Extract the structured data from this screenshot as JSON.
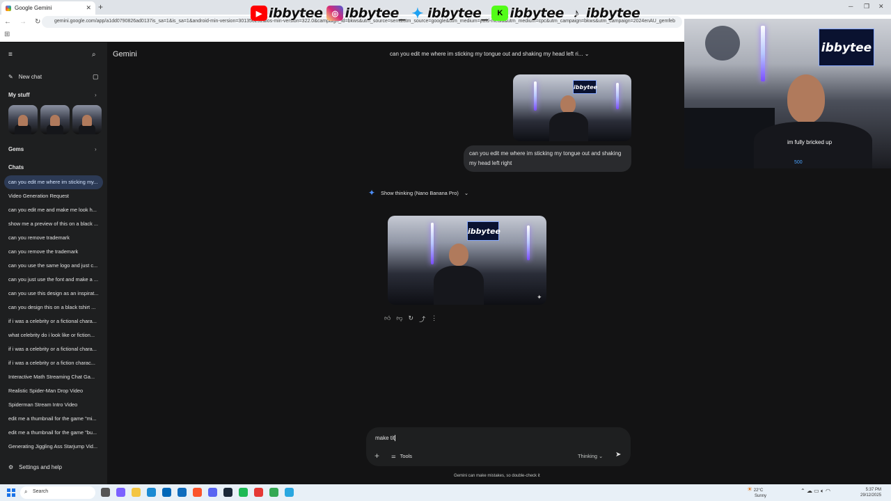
{
  "browser": {
    "tab_title": "Google Gemini",
    "url": "gemini.google.com/app/a1dd0790826ad0137is_sa=1&is_sa=1&android-min-version=301356232&ios-min-version=322.0&campaign_id=bkws&utm_source=sem&utm_source=google&utm_medium=paid-media&utm_medium=cpc&utm_campaign=bkws&utm_campaign=2024enAU_gemfeb"
  },
  "banner": {
    "handles": [
      {
        "platform": "youtube-icon",
        "handle": "ibbytee",
        "color": "#ff0000"
      },
      {
        "platform": "instagram-icon",
        "handle": "ibbytee_",
        "color": "#d62976"
      },
      {
        "platform": "twitter-icon",
        "handle": "ibbytee_",
        "color": "#1da1f2"
      },
      {
        "platform": "kick-icon",
        "handle": "ibbytee",
        "color": "#53fc18"
      },
      {
        "platform": "tiktok-icon",
        "handle": "ibbytee",
        "color": "#111111"
      }
    ]
  },
  "sidebar": {
    "new_chat": "New chat",
    "my_stuff": "My stuff",
    "gems": "Gems",
    "chats_heading": "Chats",
    "chats": [
      "can you edit me where im sticking my...",
      "Video Generation Request",
      "can you edit me and make me look h...",
      "show me a preview of this on a black ...",
      "can you remove trademark",
      "can you remove the trademark",
      "can you use the same logo and just c...",
      "can you just use the font and make a ...",
      "can you use this design as an inspirat...",
      "can you design this on a black tshirt ...",
      "if i was a celebrity or a fictional chara...",
      "what celebrity do i look like or fiction...",
      "if i was a celebrity or a fictional chara...",
      "if i was a celebrity or a fiction charac...",
      "Interactive Math Streaming Chat Ga...",
      "Realistic Spider-Man Drop Video",
      "Spiderman Stream Intro Video",
      "edit me a thumbnail for the game \"mi...",
      "edit me a thumbnail for the game \"bu...",
      "Generating Jiggling Ass Starjump Vid..."
    ],
    "settings": "Settings and help"
  },
  "main": {
    "app_name": "Gemini",
    "conversation_title": "can you edit me where im sticking my tongue out and shaking my head left ri...",
    "user_message": "can you edit me where im sticking my tongue out and shaking my head left right",
    "thinking_label": "Show thinking (Nano Banana Pro)",
    "image_logo_text": "ibbytee",
    "composer_text": "make tit",
    "tools_label": "Tools",
    "mode_label": "Thinking",
    "disclaimer": "Gemini can make mistakes, so double-check it"
  },
  "webcam": {
    "logo_text": "ibbytee",
    "shirt_text": "im fully bricked up",
    "shirt_number": "500"
  },
  "taskbar": {
    "search_placeholder": "Search",
    "weather_temp": "22°C",
    "weather_desc": "Sunny",
    "time": "5:37 PM",
    "date": "29/12/2025"
  }
}
